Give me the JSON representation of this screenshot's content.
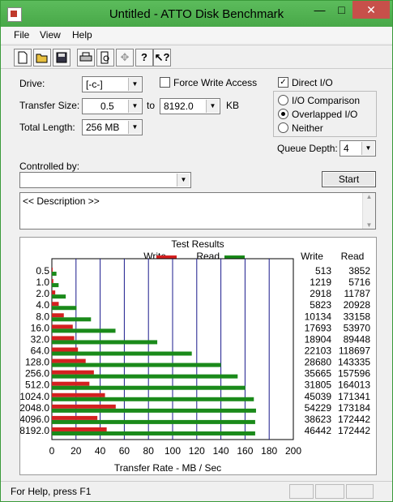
{
  "window": {
    "title": "Untitled - ATTO Disk Benchmark",
    "minimize": "—",
    "maximize": "□",
    "close": "✕"
  },
  "menu": [
    "File",
    "View",
    "Help"
  ],
  "toolbar": [
    "new-icon",
    "open-icon",
    "save-icon",
    "print-icon",
    "print-preview-icon",
    "move-icon",
    "help-icon",
    "context-help-icon"
  ],
  "form": {
    "drive_label": "Drive:",
    "drive_value": "[-c-]",
    "force_write_label": "Force Write Access",
    "force_write_checked": false,
    "direct_io_label": "Direct I/O",
    "direct_io_checked": true,
    "transfer_size_label": "Transfer Size:",
    "transfer_from": "0.5",
    "to_label": "to",
    "transfer_to": "8192.0",
    "kb_label": "KB",
    "total_length_label": "Total Length:",
    "total_length_value": "256 MB",
    "io_comparison_label": "I/O Comparison",
    "overlapped_io_label": "Overlapped I/O",
    "neither_label": "Neither",
    "selected_io_mode": "Overlapped I/O",
    "queue_depth_label": "Queue Depth:",
    "queue_depth_value": "4",
    "controlled_by_label": "Controlled by:",
    "controlled_by_value": "",
    "start_button": "Start",
    "description": "<< Description >>"
  },
  "results": {
    "title": "Test Results",
    "write_col": "Write",
    "read_col": "Read"
  },
  "chart_data": {
    "type": "bar",
    "orientation": "horizontal",
    "title": "Test Results",
    "xlabel": "Transfer Rate - MB / Sec",
    "xlim": [
      0,
      200
    ],
    "xticks": [
      "0",
      "20",
      "40",
      "60",
      "80",
      "100",
      "120",
      "140",
      "160",
      "180",
      "200"
    ],
    "grid": true,
    "legend": "top",
    "categories": [
      "0.5",
      "1.0",
      "2.0",
      "4.0",
      "8.0",
      "16.0",
      "32.0",
      "64.0",
      "128.0",
      "256.0",
      "512.0",
      "1024.0",
      "2048.0",
      "4096.0",
      "8192.0"
    ],
    "series": [
      {
        "name": "Write",
        "color": "#d42020",
        "values": [
          0.5,
          1.2,
          2.8,
          5.7,
          9.9,
          17.3,
          18.5,
          21.6,
          28.0,
          34.8,
          31.1,
          44.0,
          52.9,
          37.7,
          45.4
        ],
        "labels": [
          "513",
          "1219",
          "2918",
          "5823",
          "10134",
          "17693",
          "18904",
          "22103",
          "28680",
          "35665",
          "31805",
          "45039",
          "54229",
          "38623",
          "46442"
        ]
      },
      {
        "name": "Read",
        "color": "#1a8a1a",
        "values": [
          3.8,
          5.6,
          11.5,
          20.4,
          32.4,
          52.7,
          87.3,
          115.9,
          140.0,
          153.9,
          160.2,
          167.3,
          169.1,
          168.4,
          168.4
        ],
        "labels": [
          "3852",
          "5716",
          "11787",
          "20928",
          "33158",
          "53970",
          "89448",
          "118697",
          "143335",
          "157596",
          "164013",
          "171341",
          "173184",
          "172442",
          "172442"
        ]
      }
    ]
  },
  "status": {
    "text": "For Help, press F1"
  }
}
